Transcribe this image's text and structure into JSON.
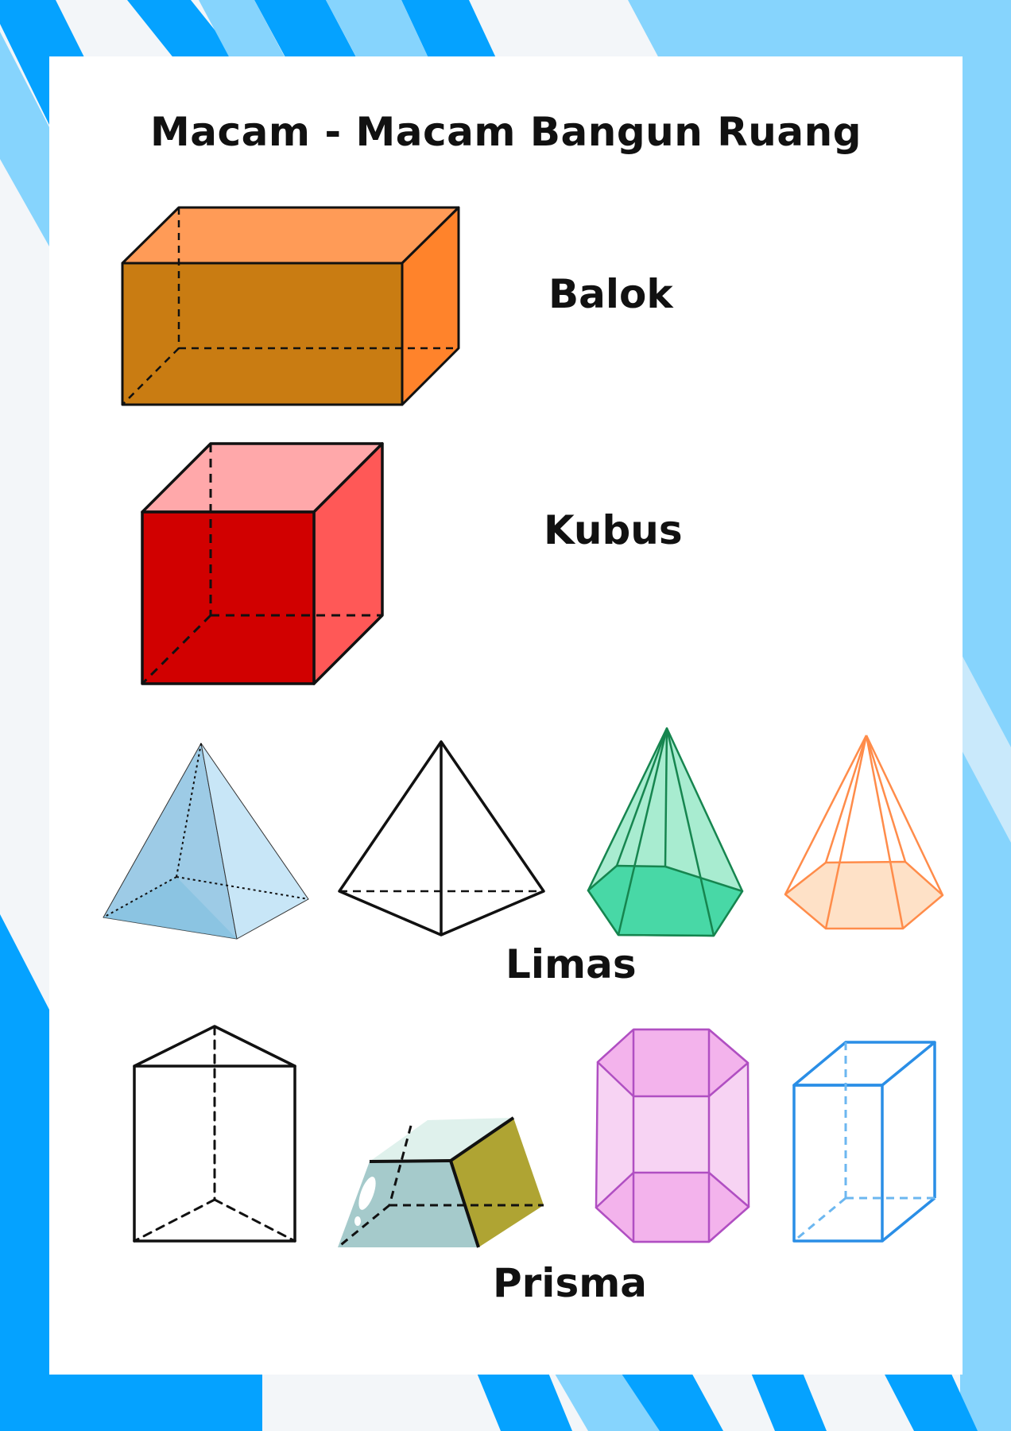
{
  "title": "Macam - Macam Bangun Ruang",
  "sections": {
    "balok": "Balok",
    "kubus": "Kubus",
    "limas": "Limas",
    "prisma": "Prisma"
  },
  "colors": {
    "frame_blue": "#05a2ff",
    "frame_light_blue": "#86d4fd",
    "balok_front": "#c97c12",
    "kubus_front": "#d10000",
    "limas_green": "#48d8a6",
    "limas_orange": "#ff8c4a",
    "prisma_pink": "#f3b3ec",
    "prisma_blue": "#2a8ee6"
  }
}
